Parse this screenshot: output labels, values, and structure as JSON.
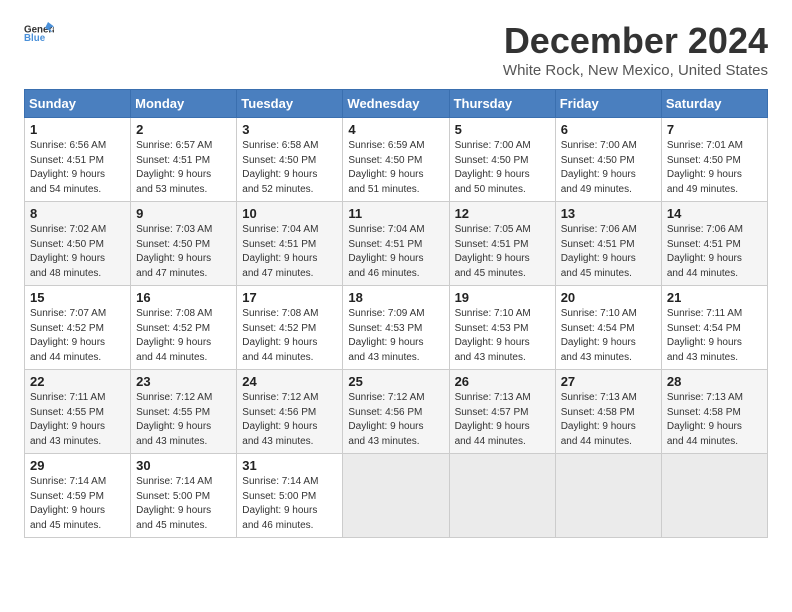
{
  "header": {
    "logo_general": "General",
    "logo_blue": "Blue",
    "month_title": "December 2024",
    "location": "White Rock, New Mexico, United States"
  },
  "days_of_week": [
    "Sunday",
    "Monday",
    "Tuesday",
    "Wednesday",
    "Thursday",
    "Friday",
    "Saturday"
  ],
  "weeks": [
    [
      {
        "day": 1,
        "info": "Sunrise: 6:56 AM\nSunset: 4:51 PM\nDaylight: 9 hours\nand 54 minutes."
      },
      {
        "day": 2,
        "info": "Sunrise: 6:57 AM\nSunset: 4:51 PM\nDaylight: 9 hours\nand 53 minutes."
      },
      {
        "day": 3,
        "info": "Sunrise: 6:58 AM\nSunset: 4:50 PM\nDaylight: 9 hours\nand 52 minutes."
      },
      {
        "day": 4,
        "info": "Sunrise: 6:59 AM\nSunset: 4:50 PM\nDaylight: 9 hours\nand 51 minutes."
      },
      {
        "day": 5,
        "info": "Sunrise: 7:00 AM\nSunset: 4:50 PM\nDaylight: 9 hours\nand 50 minutes."
      },
      {
        "day": 6,
        "info": "Sunrise: 7:00 AM\nSunset: 4:50 PM\nDaylight: 9 hours\nand 49 minutes."
      },
      {
        "day": 7,
        "info": "Sunrise: 7:01 AM\nSunset: 4:50 PM\nDaylight: 9 hours\nand 49 minutes."
      }
    ],
    [
      {
        "day": 8,
        "info": "Sunrise: 7:02 AM\nSunset: 4:50 PM\nDaylight: 9 hours\nand 48 minutes."
      },
      {
        "day": 9,
        "info": "Sunrise: 7:03 AM\nSunset: 4:50 PM\nDaylight: 9 hours\nand 47 minutes."
      },
      {
        "day": 10,
        "info": "Sunrise: 7:04 AM\nSunset: 4:51 PM\nDaylight: 9 hours\nand 47 minutes."
      },
      {
        "day": 11,
        "info": "Sunrise: 7:04 AM\nSunset: 4:51 PM\nDaylight: 9 hours\nand 46 minutes."
      },
      {
        "day": 12,
        "info": "Sunrise: 7:05 AM\nSunset: 4:51 PM\nDaylight: 9 hours\nand 45 minutes."
      },
      {
        "day": 13,
        "info": "Sunrise: 7:06 AM\nSunset: 4:51 PM\nDaylight: 9 hours\nand 45 minutes."
      },
      {
        "day": 14,
        "info": "Sunrise: 7:06 AM\nSunset: 4:51 PM\nDaylight: 9 hours\nand 44 minutes."
      }
    ],
    [
      {
        "day": 15,
        "info": "Sunrise: 7:07 AM\nSunset: 4:52 PM\nDaylight: 9 hours\nand 44 minutes."
      },
      {
        "day": 16,
        "info": "Sunrise: 7:08 AM\nSunset: 4:52 PM\nDaylight: 9 hours\nand 44 minutes."
      },
      {
        "day": 17,
        "info": "Sunrise: 7:08 AM\nSunset: 4:52 PM\nDaylight: 9 hours\nand 44 minutes."
      },
      {
        "day": 18,
        "info": "Sunrise: 7:09 AM\nSunset: 4:53 PM\nDaylight: 9 hours\nand 43 minutes."
      },
      {
        "day": 19,
        "info": "Sunrise: 7:10 AM\nSunset: 4:53 PM\nDaylight: 9 hours\nand 43 minutes."
      },
      {
        "day": 20,
        "info": "Sunrise: 7:10 AM\nSunset: 4:54 PM\nDaylight: 9 hours\nand 43 minutes."
      },
      {
        "day": 21,
        "info": "Sunrise: 7:11 AM\nSunset: 4:54 PM\nDaylight: 9 hours\nand 43 minutes."
      }
    ],
    [
      {
        "day": 22,
        "info": "Sunrise: 7:11 AM\nSunset: 4:55 PM\nDaylight: 9 hours\nand 43 minutes."
      },
      {
        "day": 23,
        "info": "Sunrise: 7:12 AM\nSunset: 4:55 PM\nDaylight: 9 hours\nand 43 minutes."
      },
      {
        "day": 24,
        "info": "Sunrise: 7:12 AM\nSunset: 4:56 PM\nDaylight: 9 hours\nand 43 minutes."
      },
      {
        "day": 25,
        "info": "Sunrise: 7:12 AM\nSunset: 4:56 PM\nDaylight: 9 hours\nand 43 minutes."
      },
      {
        "day": 26,
        "info": "Sunrise: 7:13 AM\nSunset: 4:57 PM\nDaylight: 9 hours\nand 44 minutes."
      },
      {
        "day": 27,
        "info": "Sunrise: 7:13 AM\nSunset: 4:58 PM\nDaylight: 9 hours\nand 44 minutes."
      },
      {
        "day": 28,
        "info": "Sunrise: 7:13 AM\nSunset: 4:58 PM\nDaylight: 9 hours\nand 44 minutes."
      }
    ],
    [
      {
        "day": 29,
        "info": "Sunrise: 7:14 AM\nSunset: 4:59 PM\nDaylight: 9 hours\nand 45 minutes."
      },
      {
        "day": 30,
        "info": "Sunrise: 7:14 AM\nSunset: 5:00 PM\nDaylight: 9 hours\nand 45 minutes."
      },
      {
        "day": 31,
        "info": "Sunrise: 7:14 AM\nSunset: 5:00 PM\nDaylight: 9 hours\nand 46 minutes."
      },
      null,
      null,
      null,
      null
    ]
  ]
}
